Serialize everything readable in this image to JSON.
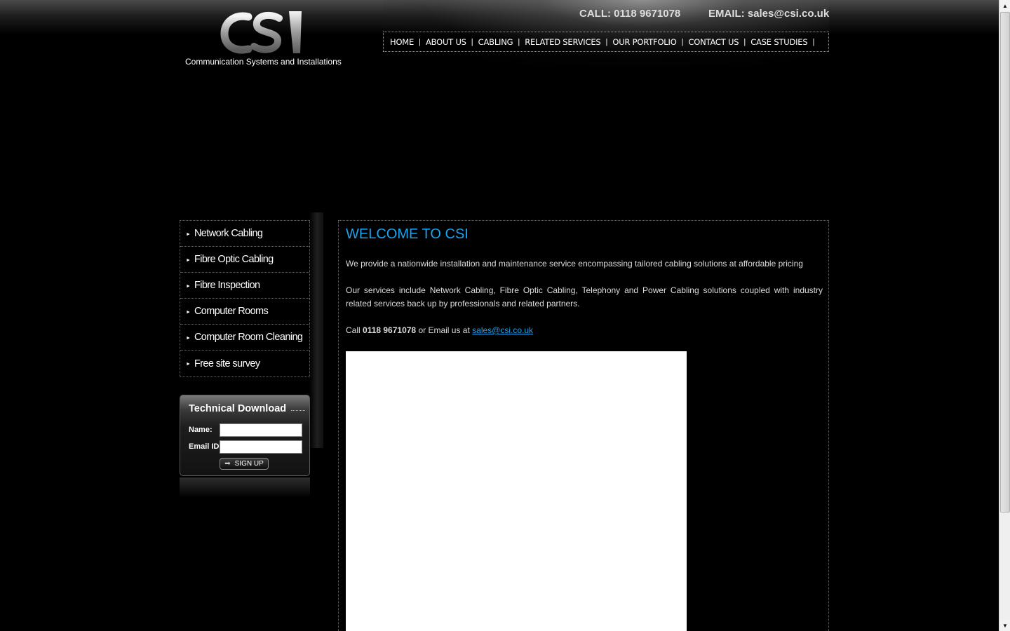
{
  "header": {
    "logo_text": "CSI",
    "tagline": "Communication Systems and Installations",
    "call": "CALL: 0118 9671078",
    "email": "EMAIL: sales@csi.co.uk"
  },
  "nav": {
    "items": [
      {
        "label": "HOME"
      },
      {
        "label": "ABOUT US"
      },
      {
        "label": "CABLING"
      },
      {
        "label": "RELATED SERVICES"
      },
      {
        "label": "OUR PORTFOLIO"
      },
      {
        "label": "CONTACT US"
      },
      {
        "label": "CASE STUDIES"
      }
    ],
    "separator": "|"
  },
  "sidebar": {
    "bullet": "►",
    "items": [
      {
        "label": "Network Cabling"
      },
      {
        "label": "Fibre Optic Cabling"
      },
      {
        "label": "Fibre Inspection"
      },
      {
        "label": "Computer Rooms"
      },
      {
        "label": "Computer Room Cleaning"
      },
      {
        "label": "Free site survey"
      }
    ]
  },
  "tech_download": {
    "title": "Technical Download",
    "name_label": "Name:",
    "email_label": "Email ID:",
    "name_value": "",
    "email_value": "",
    "button_label": "SIGN UP",
    "button_arrow": "➡"
  },
  "main": {
    "title": "WELCOME TO CSI",
    "para1": "We provide a nationwide installation and maintenance service encompassing tailored cabling solutions at affordable pricing",
    "para2": "Our services include Network Cabling, Fibre Optic Cabling, Telephony and Power Cabling solutions coupled with industry related services back up by professionals and related partners.",
    "call_prefix": "Call ",
    "call_number": "0118 9671078",
    "call_middle": " or Email us at ",
    "email_link": "sales@csi.co.uk"
  },
  "colors": {
    "accent": "#1ba3ee",
    "background": "#000000",
    "text": "#dddddd"
  },
  "scrollbar": {
    "up_icon": "▲",
    "down_icon": "▼"
  }
}
